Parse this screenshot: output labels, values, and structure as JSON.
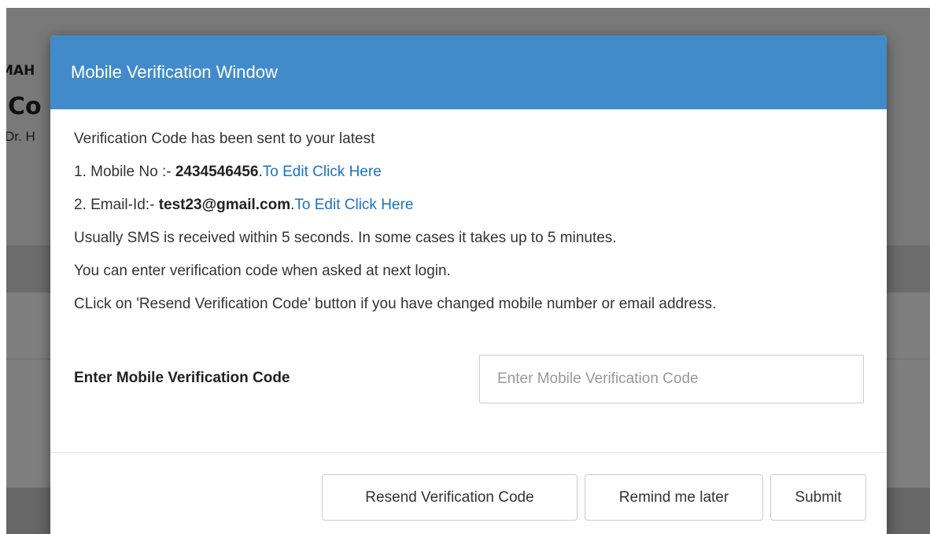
{
  "background": {
    "org_prefix": "MAH",
    "org_title": "Co",
    "org_sub": "Dr. H"
  },
  "modal": {
    "title": "Mobile Verification Window",
    "body": {
      "intro": "Verification Code has been sent to your latest",
      "mobile_prefix": "1. Mobile No :- ",
      "mobile_number": "2434546456",
      "mobile_sep": ".",
      "mobile_edit_link": "To Edit Click Here",
      "email_prefix": "2. Email-Id:- ",
      "email_value": "test23@gmail.com",
      "email_sep": ".",
      "email_edit_link": "To Edit Click Here",
      "sms_note": "Usually SMS is received within 5 seconds. In some cases it takes up to 5 minutes.",
      "login_note": "You can enter verification code when asked at next login.",
      "resend_note": "CLick on 'Resend Verification Code' button if you have changed mobile number or email address."
    },
    "code_field": {
      "label": "Enter Mobile Verification Code",
      "placeholder": "Enter Mobile Verification Code",
      "value": ""
    },
    "footer": {
      "resend_label": "Resend Verification Code",
      "remind_label": "Remind me later",
      "submit_label": "Submit"
    }
  },
  "colors": {
    "header_bg": "#428bca",
    "link": "#1a73c8",
    "backdrop": "rgba(0,0,0,0.5)"
  }
}
